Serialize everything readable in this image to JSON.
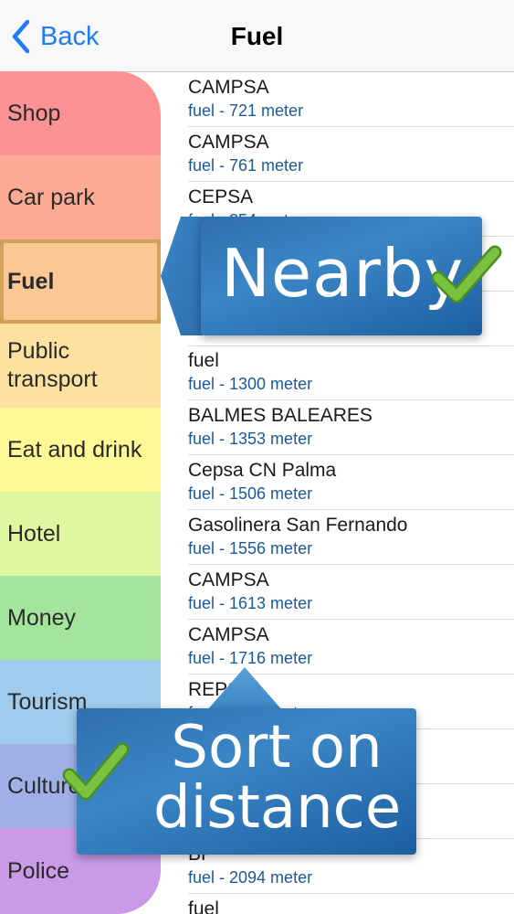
{
  "nav": {
    "back_label": "Back",
    "title": "Fuel"
  },
  "sidebar": {
    "items": [
      {
        "label": "Shop",
        "color": "#fc9294"
      },
      {
        "label": "Car park",
        "color": "#fbab92"
      },
      {
        "label": "Fuel",
        "color": "#fbc895",
        "selected": true
      },
      {
        "label": "Public transport",
        "color": "#fde29f"
      },
      {
        "label": "Eat and drink",
        "color": "#fff995"
      },
      {
        "label": "Hotel",
        "color": "#e1f6a0"
      },
      {
        "label": "Money",
        "color": "#a4e59c"
      },
      {
        "label": "Tourism",
        "color": "#9fcbec"
      },
      {
        "label": "Culture",
        "color": "#9fafe8"
      },
      {
        "label": "Police",
        "color": "#c99be7"
      }
    ]
  },
  "list": {
    "rows": [
      {
        "title": "CAMPSA",
        "sub": "fuel - 721 meter"
      },
      {
        "title": "CAMPSA",
        "sub": "fuel - 761 meter"
      },
      {
        "title": "CEPSA",
        "sub": "fuel - 854 meter"
      },
      {
        "title": "",
        "sub": ""
      },
      {
        "title": "",
        "sub": ""
      },
      {
        "title": "fuel",
        "sub": "fuel - 1300 meter"
      },
      {
        "title": "BALMES BALEARES",
        "sub": "fuel - 1353 meter"
      },
      {
        "title": "Cepsa CN Palma",
        "sub": "fuel - 1506 meter"
      },
      {
        "title": "Gasolinera San Fernando",
        "sub": "fuel - 1556 meter"
      },
      {
        "title": "CAMPSA",
        "sub": "fuel - 1613 meter"
      },
      {
        "title": "CAMPSA",
        "sub": "fuel - 1716 meter"
      },
      {
        "title": "REPSOL",
        "sub": "fuel - 1790 meter"
      },
      {
        "title": "",
        "sub": ""
      },
      {
        "title": "",
        "sub": ""
      },
      {
        "title": "BP",
        "sub": "fuel - 2094 meter"
      },
      {
        "title": "fuel",
        "sub": ""
      }
    ]
  },
  "callouts": {
    "nearby": "Nearby",
    "sort_line1": "Sort on",
    "sort_line2": "distance"
  },
  "colors": {
    "accent": "#1e7bf5",
    "callout_blue": "#2f6fae",
    "check_green": "#7ac142",
    "selected_border": "#d2a25a"
  }
}
